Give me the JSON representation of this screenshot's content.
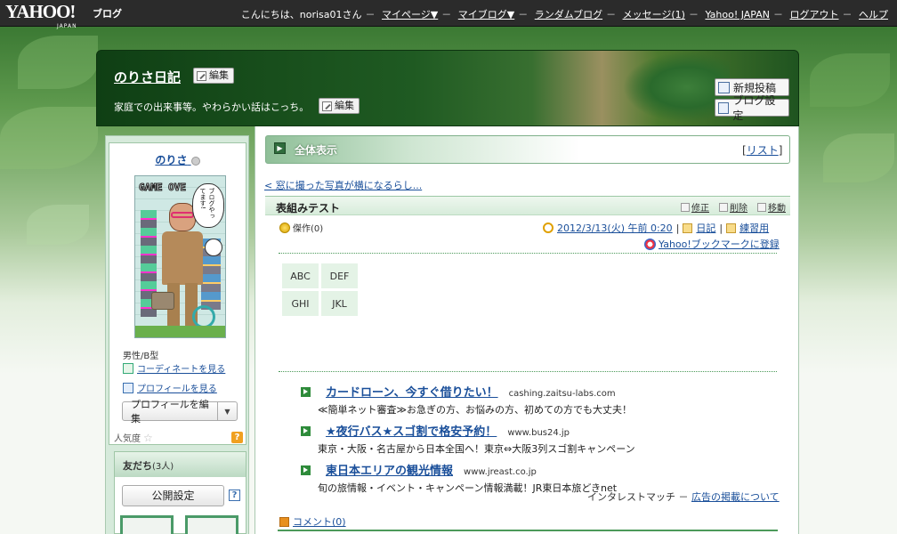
{
  "yahoo_bar": {
    "logo": "YAHOO!",
    "logo_sub": "JAPAN",
    "service": "ブログ",
    "greeting": "こんにちは、norisa01さん",
    "links": [
      "マイページ▼",
      "マイブログ▼",
      "ランダムブログ",
      "メッセージ(1)",
      "Yahoo! JAPAN",
      "ログアウト",
      "ヘルプ"
    ]
  },
  "header": {
    "blog_title": "のりさ日記",
    "edit_label": "編集",
    "description": "家庭での出来事等。やわらかい話はこっち。",
    "new_post": "新規投稿",
    "blog_settings": "ブログ設定"
  },
  "sidebar": {
    "username": "のりさ",
    "avatar_caption": "GAME OVE",
    "avatar_bubble": "ブログやってます!",
    "gender_blood": "男性/B型",
    "coordinate_link": "コーディネートを見る",
    "profile_link": "プロフィールを見る",
    "profile_edit": "プロフィールを編集",
    "popularity": "人気度",
    "friends_label": "友だち",
    "friends_count": "(3人)",
    "public_setting": "公開設定"
  },
  "main": {
    "view_all": "全体表示",
    "list_open": "[",
    "list_link": "リスト",
    "list_close": "]",
    "prev_post": "< 窓に撮った写真が横になるらし...",
    "article": {
      "title": "表組みテスト",
      "actions": [
        "修正",
        "削除",
        "移動"
      ],
      "masterpiece": "傑作(0)",
      "datetime": "2012/3/13(火) 午前 0:20",
      "category": "日記",
      "folder": "練習用",
      "bookmark": "Yahoo!ブックマークに登録",
      "table": [
        [
          "ABC",
          "DEF"
        ],
        [
          "GHI",
          "JKL"
        ]
      ]
    },
    "ads": [
      {
        "title": "カードローン、今すぐ借りたい！",
        "url": "cashing.zaitsu-labs.com",
        "desc": "≪簡単ネット審査≫お急ぎの方、お悩みの方、初めての方でも大丈夫！"
      },
      {
        "title": "★夜行バス★スゴ割で格安予約！",
        "url": "www.bus24.jp",
        "desc": "東京・大阪・名古屋から日本全国へ！東京⇔大阪3列スゴ割キャンペーン"
      },
      {
        "title": "東日本エリアの観光情報",
        "url": "www.jreast.co.jp",
        "desc": "旬の旅情報・イベント・キャンペーン情報満載！JR東日本旅どきnet"
      }
    ],
    "ad_footer_prefix": "インタレストマッチ － ",
    "ad_footer_link": "広告の掲載について",
    "comments": "コメント(0)"
  },
  "colors": {
    "top_bar": "#2b2b2b",
    "accent_green": "#2e8b3a",
    "link_blue": "#1a4f9a",
    "panel_green": "#d6eadb"
  }
}
